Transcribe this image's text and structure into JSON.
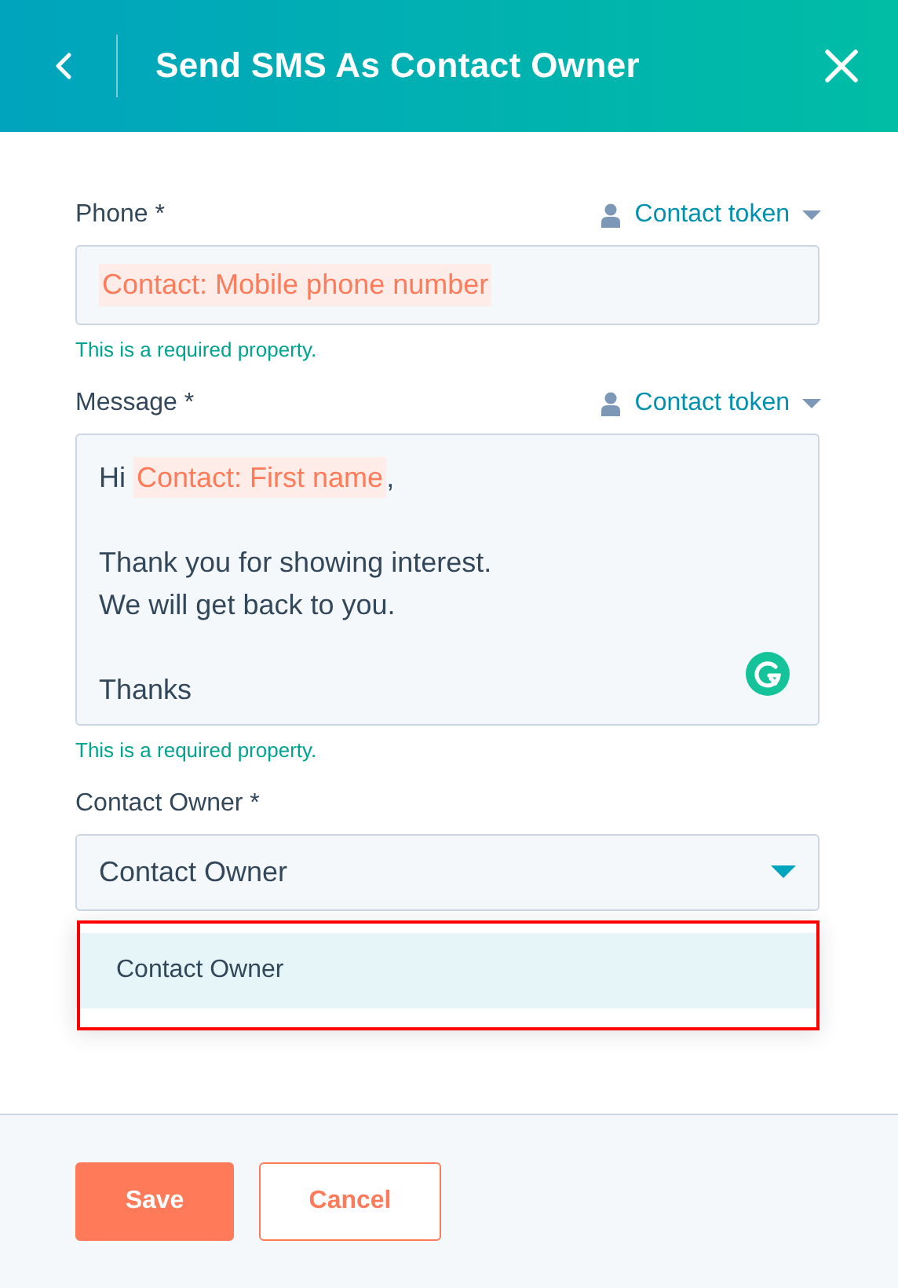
{
  "header": {
    "title": "Send SMS As Contact Owner"
  },
  "fields": [
    {
      "kind": "token-input",
      "label": "Phone *",
      "token_menu": "Contact token",
      "value": [
        {
          "kind": "token",
          "text": "Contact: Mobile phone number"
        }
      ],
      "hint": "This is a required property."
    },
    {
      "kind": "textarea",
      "label": "Message *",
      "token_menu": "Contact token",
      "paragraphs": [
        {
          "lines": [
            [
              {
                "kind": "text",
                "text": "Hi "
              },
              {
                "kind": "token",
                "text": "Contact: First name"
              },
              {
                "kind": "text",
                "text": ","
              }
            ]
          ]
        },
        {
          "lines": [
            [
              {
                "kind": "text",
                "text": "Thank you for showing interest."
              }
            ],
            [
              {
                "kind": "text",
                "text": "We will get back to you."
              }
            ]
          ]
        },
        {
          "lines": [
            [
              {
                "kind": "text",
                "text": "Thanks"
              }
            ]
          ]
        }
      ],
      "hint": "This is a required property."
    },
    {
      "kind": "select",
      "label": "Contact Owner *",
      "value": "Contact Owner",
      "expanded": true,
      "options": [
        {
          "label": "Contact Owner",
          "selected": true,
          "annotated": true
        }
      ]
    }
  ],
  "buttons": [
    {
      "label": "Save",
      "kind": "primary"
    },
    {
      "label": "Cancel",
      "kind": "secondary"
    }
  ]
}
